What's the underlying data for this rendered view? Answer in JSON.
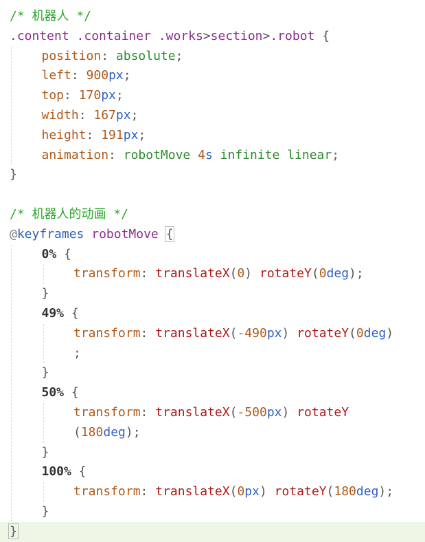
{
  "editor": {
    "colors": {
      "comment": "#2aa52a",
      "selector": "#8b2f8b",
      "property": "#b05a1a",
      "value": "#2e8b2e",
      "number": "#b05a1a",
      "unit": "#2e60c8",
      "function": "#b01818",
      "current_line": "#eef7e6"
    },
    "lines": [
      {
        "indent": 0,
        "tokens": [
          {
            "t": "/* 机器人 */",
            "c": "comment"
          }
        ]
      },
      {
        "indent": 0,
        "tokens": [
          {
            "t": ".content",
            "c": "selector"
          },
          {
            "t": " ",
            "c": "punct"
          },
          {
            "t": ".container",
            "c": "selector"
          },
          {
            "t": " ",
            "c": "punct"
          },
          {
            "t": ".works",
            "c": "selector"
          },
          {
            "t": ">",
            "c": "punct"
          },
          {
            "t": "section",
            "c": "selector"
          },
          {
            "t": ">",
            "c": "punct"
          },
          {
            "t": ".robot",
            "c": "selector"
          },
          {
            "t": " {",
            "c": "punct"
          }
        ]
      },
      {
        "indent": 1,
        "tokens": [
          {
            "t": "position",
            "c": "prop"
          },
          {
            "t": ": ",
            "c": "punct"
          },
          {
            "t": "absolute",
            "c": "value"
          },
          {
            "t": ";",
            "c": "punct"
          }
        ]
      },
      {
        "indent": 1,
        "tokens": [
          {
            "t": "left",
            "c": "prop"
          },
          {
            "t": ": ",
            "c": "punct"
          },
          {
            "t": "900",
            "c": "num"
          },
          {
            "t": "px",
            "c": "unit"
          },
          {
            "t": ";",
            "c": "punct"
          }
        ]
      },
      {
        "indent": 1,
        "tokens": [
          {
            "t": "top",
            "c": "prop"
          },
          {
            "t": ": ",
            "c": "punct"
          },
          {
            "t": "170",
            "c": "num"
          },
          {
            "t": "px",
            "c": "unit"
          },
          {
            "t": ";",
            "c": "punct"
          }
        ]
      },
      {
        "indent": 1,
        "tokens": [
          {
            "t": "width",
            "c": "prop"
          },
          {
            "t": ": ",
            "c": "punct"
          },
          {
            "t": "167",
            "c": "num"
          },
          {
            "t": "px",
            "c": "unit"
          },
          {
            "t": ";",
            "c": "punct"
          }
        ]
      },
      {
        "indent": 1,
        "tokens": [
          {
            "t": "height",
            "c": "prop"
          },
          {
            "t": ": ",
            "c": "punct"
          },
          {
            "t": "191",
            "c": "num"
          },
          {
            "t": "px",
            "c": "unit"
          },
          {
            "t": ";",
            "c": "punct"
          }
        ]
      },
      {
        "indent": 1,
        "tokens": [
          {
            "t": "animation",
            "c": "prop"
          },
          {
            "t": ": ",
            "c": "punct"
          },
          {
            "t": "robotMove",
            "c": "value"
          },
          {
            "t": " ",
            "c": "punct"
          },
          {
            "t": "4",
            "c": "num"
          },
          {
            "t": "s",
            "c": "unit"
          },
          {
            "t": " ",
            "c": "punct"
          },
          {
            "t": "infinite",
            "c": "value"
          },
          {
            "t": " ",
            "c": "punct"
          },
          {
            "t": "linear",
            "c": "value"
          },
          {
            "t": ";",
            "c": "punct"
          }
        ]
      },
      {
        "indent": 0,
        "tokens": [
          {
            "t": "}",
            "c": "punct"
          }
        ]
      },
      {
        "indent": 0,
        "tokens": []
      },
      {
        "indent": 0,
        "tokens": [
          {
            "t": "/* 机器人的动画 */",
            "c": "comment"
          }
        ]
      },
      {
        "indent": 0,
        "tokens": [
          {
            "t": "@",
            "c": "at"
          },
          {
            "t": "keyframes",
            "c": "keyword"
          },
          {
            "t": " ",
            "c": "punct"
          },
          {
            "t": "robotMove",
            "c": "name"
          },
          {
            "t": " ",
            "c": "punct"
          },
          {
            "t": "{",
            "c": "punct",
            "box": true
          }
        ]
      },
      {
        "indent": 1,
        "tokens": [
          {
            "t": "0%",
            "c": "pct"
          },
          {
            "t": " {",
            "c": "punct"
          }
        ]
      },
      {
        "indent": 2,
        "tokens": [
          {
            "t": "transform",
            "c": "prop"
          },
          {
            "t": ": ",
            "c": "punct"
          },
          {
            "t": "translateX",
            "c": "func"
          },
          {
            "t": "(",
            "c": "punct"
          },
          {
            "t": "0",
            "c": "num"
          },
          {
            "t": ") ",
            "c": "punct"
          },
          {
            "t": "rotateY",
            "c": "func"
          },
          {
            "t": "(",
            "c": "punct"
          },
          {
            "t": "0",
            "c": "num"
          },
          {
            "t": "deg",
            "c": "unit"
          },
          {
            "t": ");",
            "c": "punct"
          }
        ]
      },
      {
        "indent": 1,
        "tokens": [
          {
            "t": "}",
            "c": "punct"
          }
        ]
      },
      {
        "indent": 1,
        "tokens": [
          {
            "t": "49%",
            "c": "pct"
          },
          {
            "t": " {",
            "c": "punct"
          }
        ]
      },
      {
        "indent": 2,
        "tokens": [
          {
            "t": "transform",
            "c": "prop"
          },
          {
            "t": ": ",
            "c": "punct"
          },
          {
            "t": "translateX",
            "c": "func"
          },
          {
            "t": "(",
            "c": "punct"
          },
          {
            "t": "-490",
            "c": "num"
          },
          {
            "t": "px",
            "c": "unit"
          },
          {
            "t": ") ",
            "c": "punct"
          },
          {
            "t": "rotateY",
            "c": "func"
          },
          {
            "t": "(",
            "c": "punct"
          },
          {
            "t": "0",
            "c": "num"
          },
          {
            "t": "deg",
            "c": "unit"
          },
          {
            "t": ")",
            "c": "punct"
          }
        ]
      },
      {
        "indent": 2,
        "tokens": [
          {
            "t": ";",
            "c": "punct"
          }
        ]
      },
      {
        "indent": 1,
        "tokens": [
          {
            "t": "}",
            "c": "punct"
          }
        ]
      },
      {
        "indent": 1,
        "tokens": [
          {
            "t": "50%",
            "c": "pct"
          },
          {
            "t": " {",
            "c": "punct"
          }
        ]
      },
      {
        "indent": 2,
        "tokens": [
          {
            "t": "transform",
            "c": "prop"
          },
          {
            "t": ": ",
            "c": "punct"
          },
          {
            "t": "translateX",
            "c": "func"
          },
          {
            "t": "(",
            "c": "punct"
          },
          {
            "t": "-500",
            "c": "num"
          },
          {
            "t": "px",
            "c": "unit"
          },
          {
            "t": ") ",
            "c": "punct"
          },
          {
            "t": "rotateY",
            "c": "func"
          }
        ]
      },
      {
        "indent": 2,
        "tokens": [
          {
            "t": "(",
            "c": "punct"
          },
          {
            "t": "180",
            "c": "num"
          },
          {
            "t": "deg",
            "c": "unit"
          },
          {
            "t": ");",
            "c": "punct"
          }
        ]
      },
      {
        "indent": 1,
        "tokens": [
          {
            "t": "}",
            "c": "punct"
          }
        ]
      },
      {
        "indent": 1,
        "tokens": [
          {
            "t": "100%",
            "c": "pct"
          },
          {
            "t": " {",
            "c": "punct"
          }
        ]
      },
      {
        "indent": 2,
        "tokens": [
          {
            "t": "transform",
            "c": "prop"
          },
          {
            "t": ": ",
            "c": "punct"
          },
          {
            "t": "translateX",
            "c": "func"
          },
          {
            "t": "(",
            "c": "punct"
          },
          {
            "t": "0",
            "c": "num"
          },
          {
            "t": "px",
            "c": "unit"
          },
          {
            "t": ") ",
            "c": "punct"
          },
          {
            "t": "rotateY",
            "c": "func"
          },
          {
            "t": "(",
            "c": "punct"
          },
          {
            "t": "180",
            "c": "num"
          },
          {
            "t": "deg",
            "c": "unit"
          },
          {
            "t": ");",
            "c": "punct"
          }
        ]
      },
      {
        "indent": 1,
        "tokens": [
          {
            "t": "}",
            "c": "punct"
          }
        ]
      },
      {
        "indent": 0,
        "current": true,
        "tokens": [
          {
            "t": "}",
            "c": "punct",
            "box": true
          }
        ]
      }
    ]
  }
}
